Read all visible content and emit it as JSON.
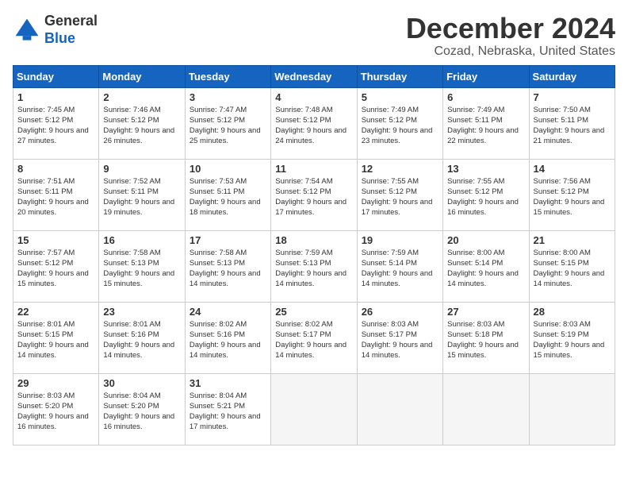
{
  "header": {
    "logo_line1": "General",
    "logo_line2": "Blue",
    "month": "December 2024",
    "location": "Cozad, Nebraska, United States"
  },
  "weekdays": [
    "Sunday",
    "Monday",
    "Tuesday",
    "Wednesday",
    "Thursday",
    "Friday",
    "Saturday"
  ],
  "weeks": [
    [
      {
        "day": "1",
        "sunrise": "7:45 AM",
        "sunset": "5:12 PM",
        "daylight": "9 hours and 27 minutes."
      },
      {
        "day": "2",
        "sunrise": "7:46 AM",
        "sunset": "5:12 PM",
        "daylight": "9 hours and 26 minutes."
      },
      {
        "day": "3",
        "sunrise": "7:47 AM",
        "sunset": "5:12 PM",
        "daylight": "9 hours and 25 minutes."
      },
      {
        "day": "4",
        "sunrise": "7:48 AM",
        "sunset": "5:12 PM",
        "daylight": "9 hours and 24 minutes."
      },
      {
        "day": "5",
        "sunrise": "7:49 AM",
        "sunset": "5:12 PM",
        "daylight": "9 hours and 23 minutes."
      },
      {
        "day": "6",
        "sunrise": "7:49 AM",
        "sunset": "5:11 PM",
        "daylight": "9 hours and 22 minutes."
      },
      {
        "day": "7",
        "sunrise": "7:50 AM",
        "sunset": "5:11 PM",
        "daylight": "9 hours and 21 minutes."
      }
    ],
    [
      {
        "day": "8",
        "sunrise": "7:51 AM",
        "sunset": "5:11 PM",
        "daylight": "9 hours and 20 minutes."
      },
      {
        "day": "9",
        "sunrise": "7:52 AM",
        "sunset": "5:11 PM",
        "daylight": "9 hours and 19 minutes."
      },
      {
        "day": "10",
        "sunrise": "7:53 AM",
        "sunset": "5:11 PM",
        "daylight": "9 hours and 18 minutes."
      },
      {
        "day": "11",
        "sunrise": "7:54 AM",
        "sunset": "5:12 PM",
        "daylight": "9 hours and 17 minutes."
      },
      {
        "day": "12",
        "sunrise": "7:55 AM",
        "sunset": "5:12 PM",
        "daylight": "9 hours and 17 minutes."
      },
      {
        "day": "13",
        "sunrise": "7:55 AM",
        "sunset": "5:12 PM",
        "daylight": "9 hours and 16 minutes."
      },
      {
        "day": "14",
        "sunrise": "7:56 AM",
        "sunset": "5:12 PM",
        "daylight": "9 hours and 15 minutes."
      }
    ],
    [
      {
        "day": "15",
        "sunrise": "7:57 AM",
        "sunset": "5:12 PM",
        "daylight": "9 hours and 15 minutes."
      },
      {
        "day": "16",
        "sunrise": "7:58 AM",
        "sunset": "5:13 PM",
        "daylight": "9 hours and 15 minutes."
      },
      {
        "day": "17",
        "sunrise": "7:58 AM",
        "sunset": "5:13 PM",
        "daylight": "9 hours and 14 minutes."
      },
      {
        "day": "18",
        "sunrise": "7:59 AM",
        "sunset": "5:13 PM",
        "daylight": "9 hours and 14 minutes."
      },
      {
        "day": "19",
        "sunrise": "7:59 AM",
        "sunset": "5:14 PM",
        "daylight": "9 hours and 14 minutes."
      },
      {
        "day": "20",
        "sunrise": "8:00 AM",
        "sunset": "5:14 PM",
        "daylight": "9 hours and 14 minutes."
      },
      {
        "day": "21",
        "sunrise": "8:00 AM",
        "sunset": "5:15 PM",
        "daylight": "9 hours and 14 minutes."
      }
    ],
    [
      {
        "day": "22",
        "sunrise": "8:01 AM",
        "sunset": "5:15 PM",
        "daylight": "9 hours and 14 minutes."
      },
      {
        "day": "23",
        "sunrise": "8:01 AM",
        "sunset": "5:16 PM",
        "daylight": "9 hours and 14 minutes."
      },
      {
        "day": "24",
        "sunrise": "8:02 AM",
        "sunset": "5:16 PM",
        "daylight": "9 hours and 14 minutes."
      },
      {
        "day": "25",
        "sunrise": "8:02 AM",
        "sunset": "5:17 PM",
        "daylight": "9 hours and 14 minutes."
      },
      {
        "day": "26",
        "sunrise": "8:03 AM",
        "sunset": "5:17 PM",
        "daylight": "9 hours and 14 minutes."
      },
      {
        "day": "27",
        "sunrise": "8:03 AM",
        "sunset": "5:18 PM",
        "daylight": "9 hours and 15 minutes."
      },
      {
        "day": "28",
        "sunrise": "8:03 AM",
        "sunset": "5:19 PM",
        "daylight": "9 hours and 15 minutes."
      }
    ],
    [
      {
        "day": "29",
        "sunrise": "8:03 AM",
        "sunset": "5:20 PM",
        "daylight": "9 hours and 16 minutes."
      },
      {
        "day": "30",
        "sunrise": "8:04 AM",
        "sunset": "5:20 PM",
        "daylight": "9 hours and 16 minutes."
      },
      {
        "day": "31",
        "sunrise": "8:04 AM",
        "sunset": "5:21 PM",
        "daylight": "9 hours and 17 minutes."
      },
      null,
      null,
      null,
      null
    ]
  ]
}
